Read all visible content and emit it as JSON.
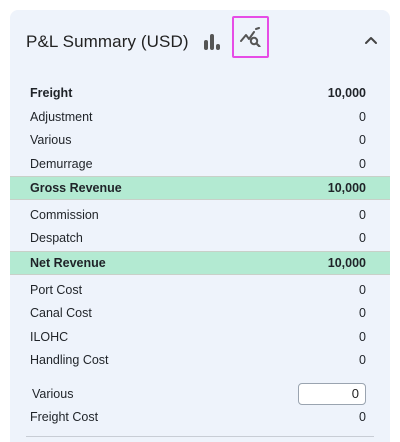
{
  "header": {
    "title": "P&L Summary (USD)"
  },
  "rows": [
    {
      "label": "Freight",
      "value": "10,000"
    },
    {
      "label": "Adjustment",
      "value": "0"
    },
    {
      "label": "Various",
      "value": "0"
    },
    {
      "label": "Demurrage",
      "value": "0"
    },
    {
      "label": "Gross Revenue",
      "value": "10,000"
    },
    {
      "label": "Commission",
      "value": "0"
    },
    {
      "label": "Despatch",
      "value": "0"
    },
    {
      "label": "Net Revenue",
      "value": "10,000"
    },
    {
      "label": "Port Cost",
      "value": "0"
    },
    {
      "label": "Canal Cost",
      "value": "0"
    },
    {
      "label": "ILOHC",
      "value": "0"
    },
    {
      "label": "Handling Cost",
      "value": "0"
    },
    {
      "label": "Various",
      "value": "0"
    },
    {
      "label": "Freight Cost",
      "value": "0"
    }
  ],
  "colors": {
    "panel_bg": "#eef3fb",
    "highlight": "#b3ead2",
    "selected_icon_border": "#e64ce6"
  },
  "icons": {
    "bar_chart": "bar-chart-icon",
    "analytics": "analytics-search-icon",
    "collapse": "chevron-up-icon"
  }
}
